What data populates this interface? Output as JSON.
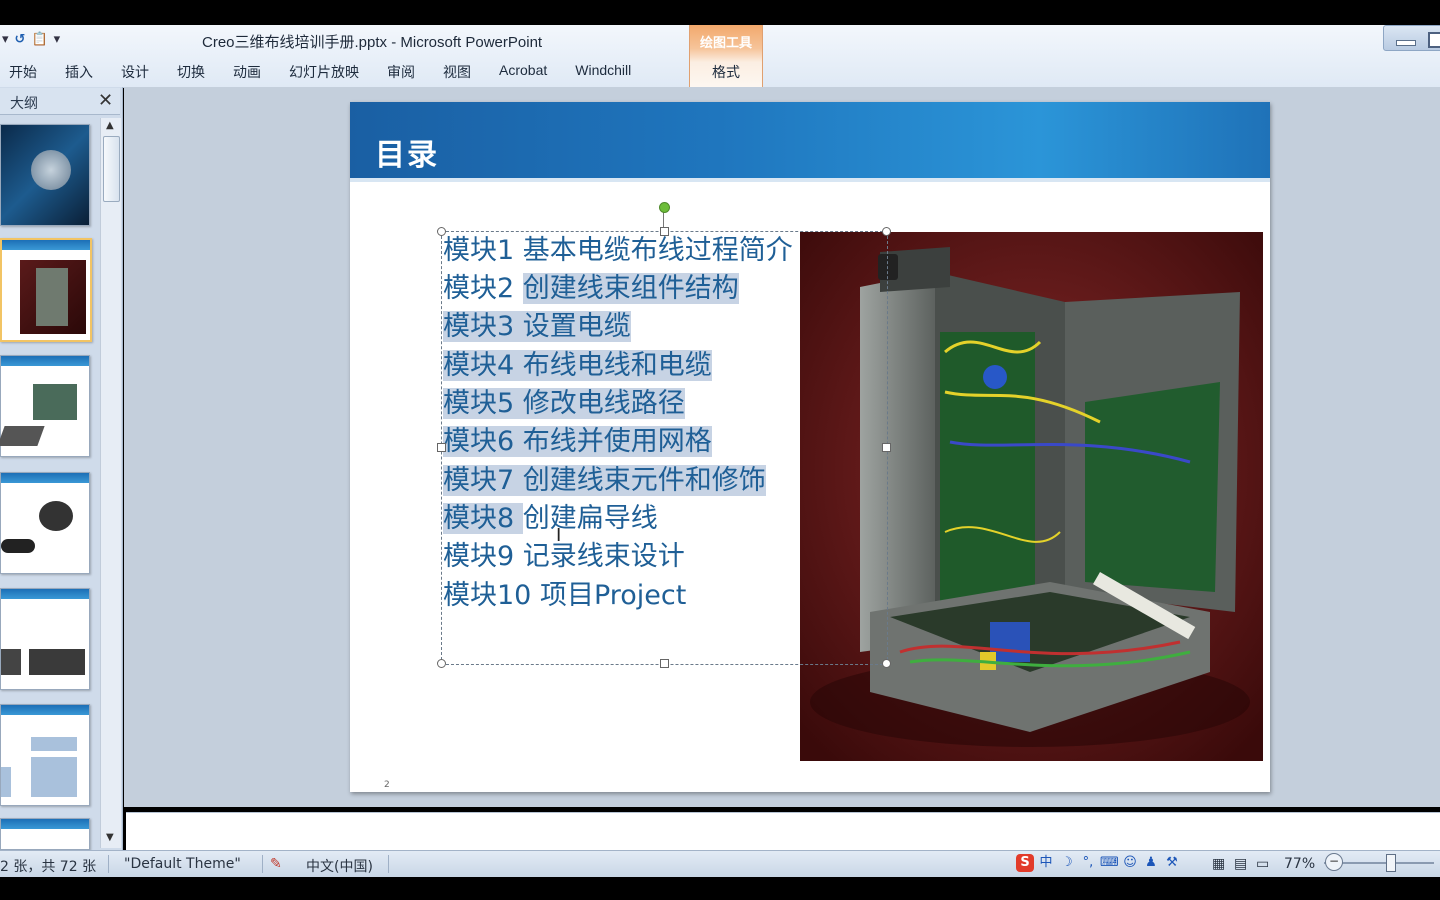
{
  "window": {
    "title": "Creo三维布线培训手册.pptx - Microsoft PowerPoint",
    "context_group_label": "绘图工具",
    "context_tab": "格式"
  },
  "ribbon": {
    "tabs": [
      "开始",
      "插入",
      "设计",
      "切换",
      "动画",
      "幻灯片放映",
      "审阅",
      "视图",
      "Acrobat",
      "Windchill"
    ]
  },
  "left_pane": {
    "tab_label": "大纲",
    "close_glyph": "✕"
  },
  "slide": {
    "title": "目录",
    "page_number": "2",
    "toc": [
      {
        "prefix": "模块1 ",
        "rest": "基本电缆布线过程简介",
        "selected": false
      },
      {
        "prefix": "模块2 ",
        "rest": "创建线束组件结构",
        "selected": true
      },
      {
        "prefix": "模块3 ",
        "rest": "设置电缆",
        "selected": true
      },
      {
        "prefix": "模块4 ",
        "rest": "布线电线和电缆",
        "selected": true
      },
      {
        "prefix": "模块5 ",
        "rest": "修改电线路径",
        "selected": true
      },
      {
        "prefix": "模块6 ",
        "rest": "布线并使用网格",
        "selected": true
      },
      {
        "prefix": "模块7 ",
        "rest": "创建线束元件和修饰",
        "selected": true
      },
      {
        "prefix": "模块8 ",
        "rest": "创建扁导线",
        "selected": true
      },
      {
        "prefix": "模块9 ",
        "rest": "记录线束设计",
        "selected": false
      },
      {
        "prefix": "模块10 ",
        "rest": "项目Project",
        "selected": false
      }
    ]
  },
  "status": {
    "slide_count": "2 张，共 72 张",
    "theme": "\"Default Theme\"",
    "language": "中文(中国)",
    "zoom": "77%"
  },
  "colors": {
    "accent": "#1f76be",
    "toc_text": "#1f5f96",
    "selection": "#c7d3e4",
    "context_tab": "#f2a86c"
  }
}
